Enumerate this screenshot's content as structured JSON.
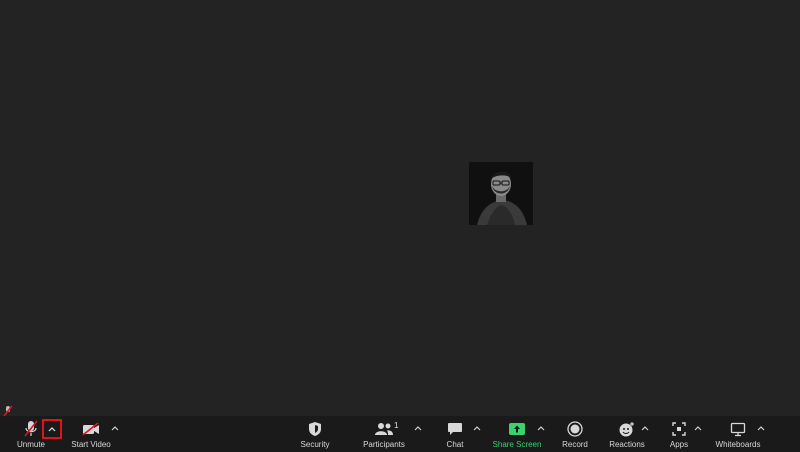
{
  "toolbar": {
    "unmute_label": "Unmute",
    "start_video_label": "Start Video",
    "security_label": "Security",
    "participants_label": "Participants",
    "participants_count": "1",
    "chat_label": "Chat",
    "share_screen_label": "Share Screen",
    "record_label": "Record",
    "reactions_label": "Reactions",
    "apps_label": "Apps",
    "whiteboards_label": "Whiteboards"
  },
  "colors": {
    "background": "#232323",
    "toolbar": "#1a1a1a",
    "share_green": "#38d36e",
    "mute_red": "#e0131a"
  },
  "icons": {
    "unmute": "microphone-muted-icon",
    "start_video": "video-off-icon",
    "security": "shield-icon",
    "participants": "people-icon",
    "chat": "chat-bubble-icon",
    "share_screen": "share-screen-icon",
    "record": "record-icon",
    "reactions": "smiley-plus-icon",
    "apps": "apps-icon",
    "whiteboards": "whiteboard-icon"
  }
}
